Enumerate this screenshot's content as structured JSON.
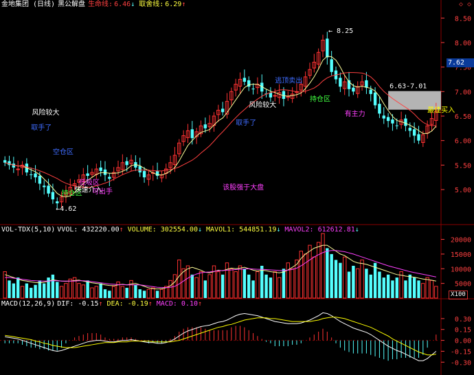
{
  "header": {
    "title": "金地集团 (日线)",
    "indicator_name": "黑公解盘",
    "lifeline_label": "生命线:",
    "lifeline_value": "6.46",
    "lifeline_arrow": "↓",
    "selloff_label": "取舍线:",
    "selloff_value": "6.29",
    "selloff_arrow": "↑"
  },
  "top_right_icons": "◇ ◇",
  "current_price_tag": "7.62",
  "volume_panel": {
    "name": "VOL-TDX(5,10)",
    "vvol": "VVOL: 432220.00",
    "vvol_arrow": "↑",
    "volume": "VOLUME: 302554.00",
    "volume_arrow": "↓",
    "mavol1": "MAVOL1: 544851.19",
    "mavol1_arrow": "↓",
    "mavol2": "MAVOL2: 612612.81",
    "mavol2_arrow": "↓",
    "scale_tag": "X100"
  },
  "macd_panel": {
    "name": "MACD(12,26,9)",
    "dif": "DIF: -0.15",
    "dif_arrow": "↑",
    "dea": "DEA: -0.19",
    "dea_arrow": "↑",
    "macd": "MACD: 0.10",
    "macd_arrow": "↑"
  },
  "colors": {
    "background": "#000000",
    "up_candle": "#ff3232",
    "down_candle": "#54ffff",
    "ma_short": "#ffff9a",
    "ma_long": "#ff4040",
    "grid": "#8b0000",
    "axis_text": "#ff4040",
    "white": "#ffffff",
    "yellow": "#ffff00",
    "magenta": "#ff40ff",
    "blue": "#3f6cff",
    "green": "#40ff40"
  },
  "chart_data": [
    {
      "type": "candlestick",
      "title": "金地集团 (日线)",
      "ylim": [
        4.3,
        8.7
      ],
      "y_ticks": [
        5.0,
        5.5,
        6.0,
        6.5,
        7.0,
        7.5,
        8.0,
        8.5
      ],
      "high_marker": "8.25",
      "low_marker": "4.62",
      "range_box_label": "6.63-7.01",
      "range_box": [
        6.63,
        7.01
      ],
      "close": [
        5.55,
        5.5,
        5.45,
        5.42,
        5.5,
        5.35,
        5.3,
        5.25,
        5.12,
        5.05,
        4.92,
        4.8,
        4.72,
        4.85,
        4.95,
        5.05,
        5.12,
        5.2,
        5.3,
        5.28,
        5.35,
        5.42,
        5.38,
        5.3,
        5.22,
        5.35,
        5.45,
        5.55,
        5.5,
        5.6,
        5.45,
        5.35,
        5.25,
        5.3,
        5.35,
        5.28,
        5.3,
        5.42,
        5.55,
        5.7,
        5.95,
        6.1,
        6.2,
        6.05,
        6.18,
        6.3,
        6.25,
        6.35,
        6.5,
        6.62,
        6.58,
        6.8,
        7.0,
        7.15,
        7.25,
        7.2,
        7.1,
        7.05,
        7.15,
        7.0,
        6.95,
        6.88,
        6.92,
        6.98,
        6.85,
        6.9,
        6.95,
        7.0,
        7.15,
        7.3,
        7.45,
        7.6,
        7.8,
        8.05,
        7.7,
        7.4,
        7.25,
        7.1,
        7.2,
        7.05,
        7.0,
        7.1,
        7.2,
        7.08,
        6.95,
        6.72,
        6.55,
        6.45,
        6.4,
        6.35,
        6.3,
        6.42,
        6.3,
        6.2,
        6.1,
        6.0,
        6.12,
        6.3,
        6.45,
        6.6
      ],
      "annotations": [
        {
          "text": "取手了",
          "color": "blue"
        },
        {
          "text": "风险较大",
          "color": "white"
        },
        {
          "text": "空仓区",
          "color": "blue"
        },
        {
          "text": "持仓区",
          "color": "green"
        },
        {
          "text": "低吸区",
          "color": "magenta"
        },
        {
          "text": "快速介入",
          "color": "white"
        },
        {
          "text": "可出手",
          "color": "magenta"
        },
        {
          "text": "该股强于大盘",
          "color": "magenta"
        },
        {
          "text": "逃顶卖出",
          "color": "blue"
        },
        {
          "text": "最佳买入",
          "color": "yellow"
        },
        {
          "text": "有主力",
          "color": "magenta"
        }
      ]
    },
    {
      "type": "bar",
      "title": "VOL-TDX(5,10)",
      "unit": "X100",
      "ylim": [
        0,
        22000
      ],
      "y_ticks": [
        5000,
        10000,
        15000,
        20000
      ],
      "series": [
        {
          "name": "VOLUME",
          "values": [
            9000,
            6000,
            5000,
            7000,
            4000,
            5000,
            3500,
            4500,
            6000,
            5000,
            7000,
            8000,
            5500,
            4000,
            5000,
            6500,
            7000,
            5000,
            4500,
            6000,
            3500,
            4000,
            5000,
            3000,
            2500,
            4000,
            5500,
            4000,
            3500,
            6000,
            4500,
            3000,
            2500,
            3000,
            3500,
            2500,
            3000,
            4000,
            6000,
            8000,
            13000,
            10000,
            11000,
            8000,
            7000,
            9000,
            6000,
            8000,
            11000,
            9000,
            8000,
            12000,
            10000,
            9000,
            11000,
            10000,
            8000,
            6000,
            9000,
            11000,
            8000,
            7000,
            9000,
            7000,
            10000,
            12000,
            10000,
            13000,
            16000,
            15000,
            18000,
            14000,
            19000,
            22000,
            17000,
            15000,
            13000,
            12000,
            14000,
            9000,
            11000,
            10000,
            13000,
            10000,
            8000,
            12000,
            9000,
            7000,
            8000,
            6000,
            7000,
            9000,
            6000,
            8000,
            7000,
            6000,
            5000,
            7000,
            6000,
            4000
          ]
        },
        {
          "name": "MAVOL1",
          "values": [
            8000,
            7500,
            7000,
            6500,
            6000,
            5800,
            5500,
            5300,
            5200,
            5400,
            5800,
            6200,
            6000,
            5800,
            5700,
            5800,
            6000,
            6100,
            5800,
            5500,
            5200,
            5000,
            4800,
            4500,
            4300,
            4200,
            4500,
            4700,
            4500,
            4800,
            5000,
            4500,
            4000,
            3500,
            3200,
            3100,
            3200,
            3500,
            4200,
            5500,
            7500,
            9000,
            10000,
            10500,
            10000,
            9500,
            8800,
            8600,
            9000,
            9500,
            9300,
            9800,
            10200,
            10000,
            10200,
            10500,
            10000,
            9500,
            9200,
            9500,
            9300,
            9000,
            8800,
            8600,
            8900,
            9600,
            10500,
            11500,
            13500,
            15000,
            16000,
            17000,
            17500,
            18000,
            18000,
            17000,
            16000,
            15000,
            14500,
            13500,
            12500,
            12000,
            11800,
            11500,
            11000,
            10500,
            10000,
            9500,
            9000,
            8500,
            8000,
            7800,
            7500,
            7300,
            7100,
            6800,
            6500,
            6300,
            6100,
            5800
          ]
        },
        {
          "name": "MAVOL2",
          "values": [
            7000,
            7000,
            6800,
            6600,
            6400,
            6200,
            6000,
            5900,
            5800,
            5800,
            5800,
            5900,
            5900,
            5800,
            5800,
            5800,
            5800,
            5900,
            5900,
            5800,
            5600,
            5400,
            5200,
            5000,
            4800,
            4700,
            4600,
            4600,
            4500,
            4500,
            4500,
            4500,
            4300,
            4100,
            3900,
            3700,
            3600,
            3600,
            3700,
            4000,
            4800,
            5800,
            6800,
            7600,
            8200,
            8600,
            8800,
            8900,
            9100,
            9300,
            9400,
            9500,
            9600,
            9700,
            9800,
            9900,
            10000,
            9900,
            9800,
            9800,
            9700,
            9600,
            9500,
            9400,
            9400,
            9500,
            9800,
            10200,
            11000,
            12000,
            13000,
            14000,
            14800,
            15500,
            16000,
            16200,
            16200,
            16000,
            15800,
            15400,
            15000,
            14500,
            14000,
            13500,
            13000,
            12500,
            12000,
            11500,
            11000,
            10600,
            10200,
            9800,
            9400,
            9000,
            8700,
            8400,
            8100,
            7800,
            7500,
            7200
          ]
        }
      ]
    },
    {
      "type": "bar",
      "title": "MACD(12,26,9)",
      "ylim": [
        -0.42,
        0.45
      ],
      "y_ticks": [
        -0.3,
        -0.15,
        0.0,
        0.15,
        0.3
      ],
      "series": [
        {
          "name": "DIF",
          "values": [
            0.05,
            0.04,
            0.03,
            0.02,
            0.0,
            -0.02,
            -0.04,
            -0.06,
            -0.08,
            -0.1,
            -0.12,
            -0.14,
            -0.15,
            -0.14,
            -0.12,
            -0.1,
            -0.08,
            -0.06,
            -0.04,
            -0.02,
            -0.01,
            0.0,
            0.0,
            -0.01,
            -0.02,
            -0.02,
            -0.01,
            0.0,
            0.0,
            0.01,
            0.0,
            -0.01,
            -0.02,
            -0.03,
            -0.03,
            -0.04,
            -0.04,
            -0.03,
            -0.01,
            0.02,
            0.06,
            0.1,
            0.13,
            0.15,
            0.17,
            0.19,
            0.2,
            0.21,
            0.23,
            0.25,
            0.26,
            0.28,
            0.31,
            0.34,
            0.36,
            0.37,
            0.36,
            0.35,
            0.34,
            0.32,
            0.3,
            0.28,
            0.26,
            0.25,
            0.24,
            0.23,
            0.23,
            0.23,
            0.24,
            0.26,
            0.28,
            0.31,
            0.34,
            0.38,
            0.37,
            0.34,
            0.3,
            0.26,
            0.23,
            0.2,
            0.17,
            0.15,
            0.13,
            0.11,
            0.08,
            0.04,
            0.0,
            -0.04,
            -0.08,
            -0.11,
            -0.14,
            -0.16,
            -0.19,
            -0.22,
            -0.25,
            -0.28,
            -0.28,
            -0.25,
            -0.2,
            -0.15
          ]
        },
        {
          "name": "DEA",
          "values": [
            0.07,
            0.06,
            0.05,
            0.04,
            0.03,
            0.02,
            0.01,
            -0.01,
            -0.02,
            -0.04,
            -0.05,
            -0.07,
            -0.08,
            -0.09,
            -0.1,
            -0.1,
            -0.1,
            -0.09,
            -0.08,
            -0.07,
            -0.06,
            -0.05,
            -0.04,
            -0.03,
            -0.03,
            -0.03,
            -0.02,
            -0.02,
            -0.02,
            -0.01,
            -0.01,
            -0.01,
            -0.01,
            -0.01,
            -0.02,
            -0.02,
            -0.02,
            -0.02,
            -0.02,
            -0.01,
            0.0,
            0.02,
            0.04,
            0.06,
            0.08,
            0.1,
            0.12,
            0.14,
            0.16,
            0.18,
            0.19,
            0.21,
            0.22,
            0.24,
            0.26,
            0.28,
            0.29,
            0.3,
            0.31,
            0.31,
            0.31,
            0.3,
            0.3,
            0.29,
            0.28,
            0.27,
            0.26,
            0.26,
            0.26,
            0.26,
            0.26,
            0.27,
            0.28,
            0.3,
            0.31,
            0.32,
            0.32,
            0.31,
            0.3,
            0.28,
            0.26,
            0.24,
            0.22,
            0.2,
            0.18,
            0.15,
            0.12,
            0.09,
            0.06,
            0.02,
            -0.01,
            -0.04,
            -0.07,
            -0.1,
            -0.13,
            -0.16,
            -0.18,
            -0.2,
            -0.2,
            -0.19
          ]
        }
      ]
    }
  ]
}
